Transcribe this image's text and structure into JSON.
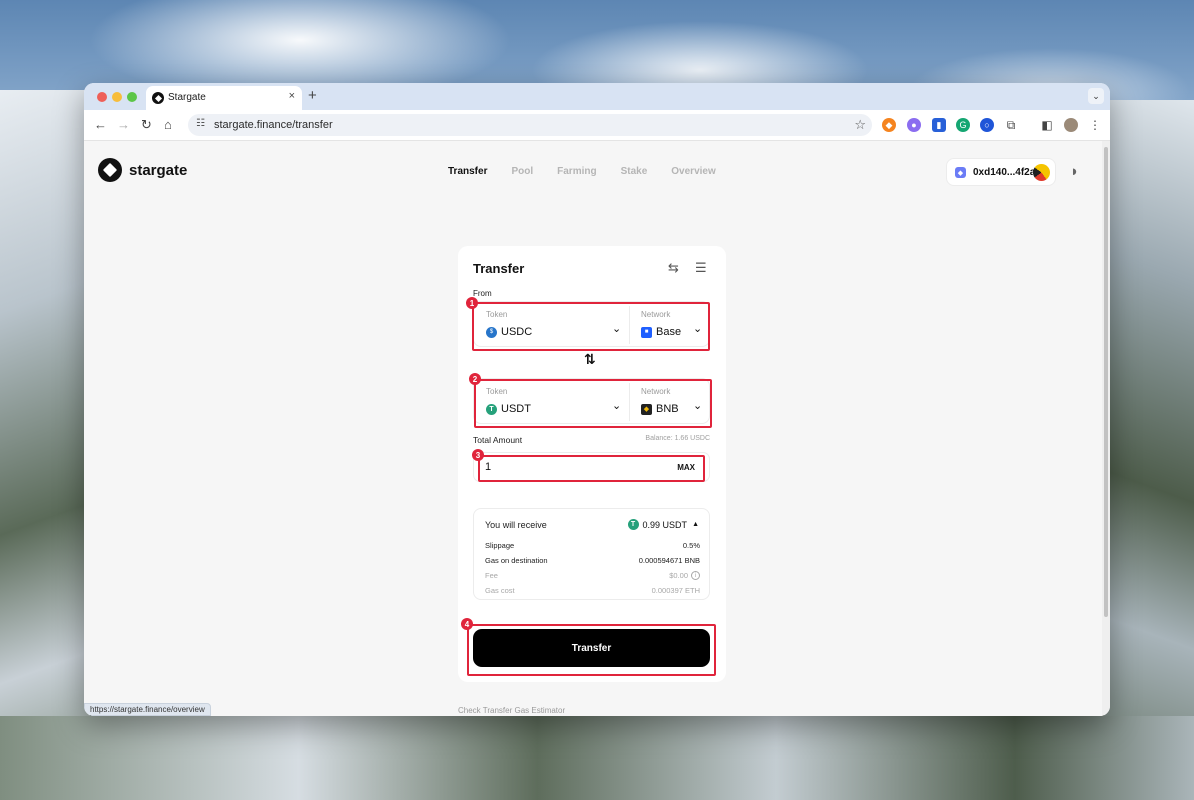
{
  "browser": {
    "tab_title": "Stargate",
    "tab_close": "×",
    "new_tab": "+",
    "tab_menu": "⌄",
    "url": "stargate.finance/transfer",
    "status_url": "https://stargate.finance/overview"
  },
  "app": {
    "brand": "stargate",
    "nav": [
      "Transfer",
      "Pool",
      "Farming",
      "Stake",
      "Overview"
    ],
    "wallet_address": "0xd140...4f2a"
  },
  "transfer": {
    "title": "Transfer",
    "from_label": "From",
    "token_label": "Token",
    "network_label": "Network",
    "from_token": "USDC",
    "from_network": "Base",
    "to_token": "USDT",
    "to_network": "BNB",
    "total_amount_label": "Total Amount",
    "balance": "Balance: 1.66 USDC",
    "amount": "1",
    "max_label": "MAX",
    "receive_label": "You will receive",
    "receive_value": "0.99 USDT",
    "details": [
      {
        "label": "Slippage",
        "value": "0.5%"
      },
      {
        "label": "Gas on destination",
        "value": "0.000594671 BNB"
      },
      {
        "label": "Fee",
        "value": "$0.00"
      },
      {
        "label": "Gas cost",
        "value": "0.000397 ETH"
      }
    ],
    "button_label": "Transfer",
    "gas_estimator_link": "Check Transfer Gas Estimator"
  },
  "annotations": [
    "1",
    "2",
    "3",
    "4"
  ],
  "colors": {
    "highlight": "#e0243b",
    "usdc": "#2775ca",
    "usdt": "#26a17b",
    "base": "#1f5fff",
    "bnb": "#f0b90b"
  }
}
